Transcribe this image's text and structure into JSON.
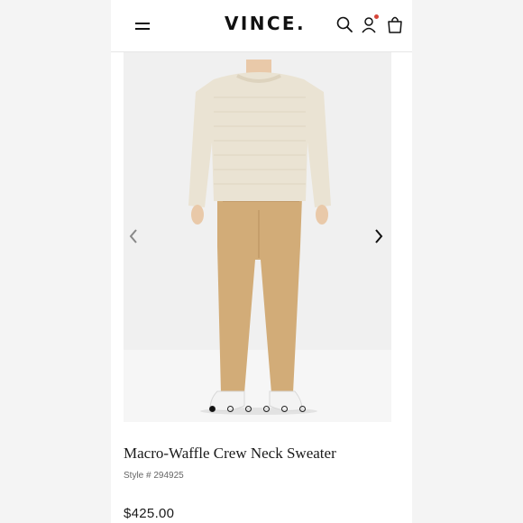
{
  "header": {
    "logo": "VINCE.",
    "menu_icon": "hamburger-menu-icon",
    "search_icon": "search-icon",
    "account_icon": "account-icon",
    "bag_icon": "shopping-bag-icon",
    "notification_color": "#d6453a"
  },
  "gallery": {
    "prev_icon": "chevron-left-icon",
    "next_icon": "chevron-right-icon",
    "slide_count": 6,
    "active_slide": 1,
    "colors": {
      "sweater": "#eae3d3",
      "pants": "#d2ac78",
      "shoes": "#f3f3f3",
      "background": "#f0f0f0"
    }
  },
  "product": {
    "title": "Macro-Waffle Crew Neck Sweater",
    "style": "Style # 294925",
    "price": "$425.00"
  }
}
